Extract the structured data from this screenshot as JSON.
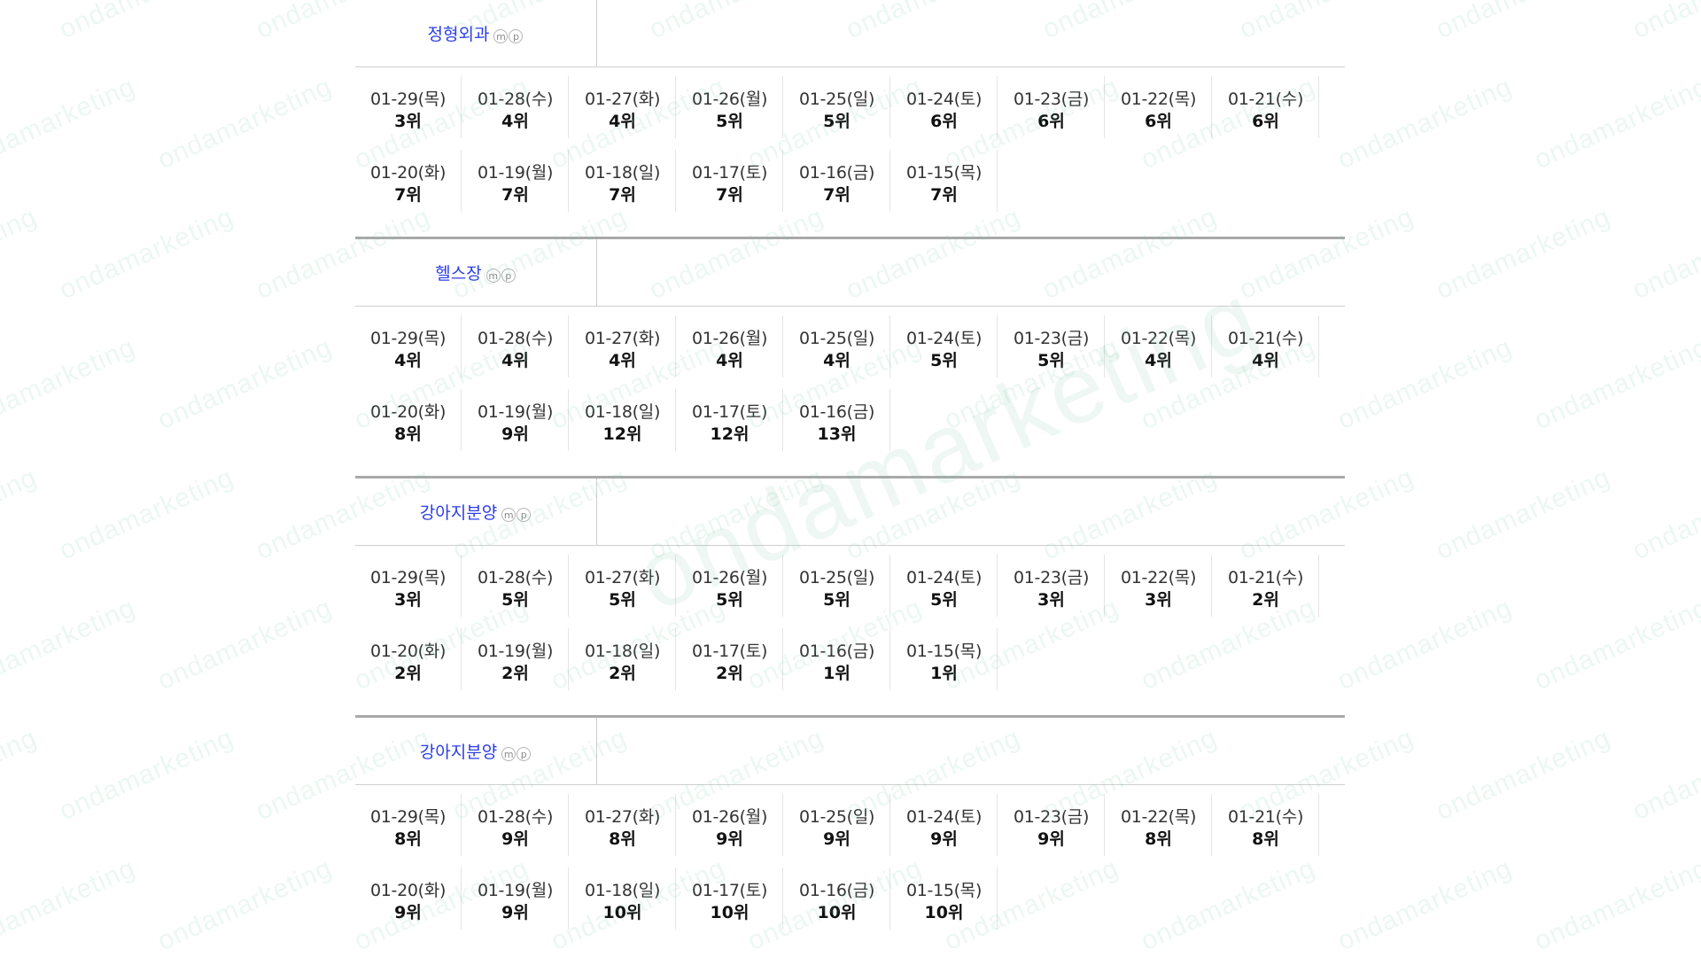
{
  "watermark": {
    "text": "ondamarketing",
    "color": "#7cc3a0"
  },
  "colors": {
    "keyword": "#2a3de8",
    "divider": "#a9a9a9",
    "border": "#cfcfcf"
  },
  "icons": {
    "m": "ⓜ",
    "p": "ⓟ",
    "m_name": "m-circle-icon",
    "p_name": "p-circle-icon"
  },
  "sections": [
    {
      "keyword": "정형외과",
      "ranks": [
        {
          "date": "01-29(목)",
          "rank": "3위"
        },
        {
          "date": "01-28(수)",
          "rank": "4위"
        },
        {
          "date": "01-27(화)",
          "rank": "4위"
        },
        {
          "date": "01-26(월)",
          "rank": "5위"
        },
        {
          "date": "01-25(일)",
          "rank": "5위"
        },
        {
          "date": "01-24(토)",
          "rank": "6위"
        },
        {
          "date": "01-23(금)",
          "rank": "6위"
        },
        {
          "date": "01-22(목)",
          "rank": "6위"
        },
        {
          "date": "01-21(수)",
          "rank": "6위"
        },
        {
          "date": "01-20(화)",
          "rank": "7위"
        },
        {
          "date": "01-19(월)",
          "rank": "7위"
        },
        {
          "date": "01-18(일)",
          "rank": "7위"
        },
        {
          "date": "01-17(토)",
          "rank": "7위"
        },
        {
          "date": "01-16(금)",
          "rank": "7위"
        },
        {
          "date": "01-15(목)",
          "rank": "7위"
        }
      ]
    },
    {
      "keyword": "헬스장",
      "ranks": [
        {
          "date": "01-29(목)",
          "rank": "4위"
        },
        {
          "date": "01-28(수)",
          "rank": "4위"
        },
        {
          "date": "01-27(화)",
          "rank": "4위"
        },
        {
          "date": "01-26(월)",
          "rank": "4위"
        },
        {
          "date": "01-25(일)",
          "rank": "4위"
        },
        {
          "date": "01-24(토)",
          "rank": "5위"
        },
        {
          "date": "01-23(금)",
          "rank": "5위"
        },
        {
          "date": "01-22(목)",
          "rank": "4위"
        },
        {
          "date": "01-21(수)",
          "rank": "4위"
        },
        {
          "date": "01-20(화)",
          "rank": "8위"
        },
        {
          "date": "01-19(월)",
          "rank": "9위"
        },
        {
          "date": "01-18(일)",
          "rank": "12위"
        },
        {
          "date": "01-17(토)",
          "rank": "12위"
        },
        {
          "date": "01-16(금)",
          "rank": "13위"
        }
      ]
    },
    {
      "keyword": "강아지분양",
      "ranks": [
        {
          "date": "01-29(목)",
          "rank": "3위"
        },
        {
          "date": "01-28(수)",
          "rank": "5위"
        },
        {
          "date": "01-27(화)",
          "rank": "5위"
        },
        {
          "date": "01-26(월)",
          "rank": "5위"
        },
        {
          "date": "01-25(일)",
          "rank": "5위"
        },
        {
          "date": "01-24(토)",
          "rank": "5위"
        },
        {
          "date": "01-23(금)",
          "rank": "3위"
        },
        {
          "date": "01-22(목)",
          "rank": "3위"
        },
        {
          "date": "01-21(수)",
          "rank": "2위"
        },
        {
          "date": "01-20(화)",
          "rank": "2위"
        },
        {
          "date": "01-19(월)",
          "rank": "2위"
        },
        {
          "date": "01-18(일)",
          "rank": "2위"
        },
        {
          "date": "01-17(토)",
          "rank": "2위"
        },
        {
          "date": "01-16(금)",
          "rank": "1위"
        },
        {
          "date": "01-15(목)",
          "rank": "1위"
        }
      ]
    },
    {
      "keyword": "강아지분양",
      "ranks": [
        {
          "date": "01-29(목)",
          "rank": "8위"
        },
        {
          "date": "01-28(수)",
          "rank": "9위"
        },
        {
          "date": "01-27(화)",
          "rank": "8위"
        },
        {
          "date": "01-26(월)",
          "rank": "9위"
        },
        {
          "date": "01-25(일)",
          "rank": "9위"
        },
        {
          "date": "01-24(토)",
          "rank": "9위"
        },
        {
          "date": "01-23(금)",
          "rank": "9위"
        },
        {
          "date": "01-22(목)",
          "rank": "8위"
        },
        {
          "date": "01-21(수)",
          "rank": "8위"
        },
        {
          "date": "01-20(화)",
          "rank": "9위"
        },
        {
          "date": "01-19(월)",
          "rank": "9위"
        },
        {
          "date": "01-18(일)",
          "rank": "10위"
        },
        {
          "date": "01-17(토)",
          "rank": "10위"
        },
        {
          "date": "01-16(금)",
          "rank": "10위"
        },
        {
          "date": "01-15(목)",
          "rank": "10위"
        }
      ]
    }
  ]
}
